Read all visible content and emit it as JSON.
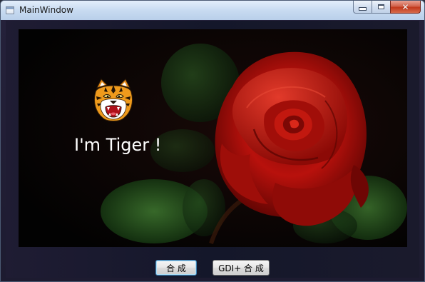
{
  "window": {
    "title": "MainWindow",
    "caption_buttons": {
      "minimize_icon": "minimize-icon",
      "maximize_icon": "maximize-icon",
      "close_icon": "close-icon",
      "close_glyph": "✕"
    }
  },
  "canvas": {
    "overlay_text": "I'm Tiger !",
    "tiger_icon": "tiger-head-icon",
    "background": "red-rose-photo"
  },
  "buttons": {
    "compose_label": "合 成",
    "gdi_compose_label": "GDI+ 合 成"
  },
  "colors": {
    "titlebar": "#c8dbf1",
    "client_bg": "#1a1a2c",
    "close_button": "#c2391d",
    "rose_red": "#c4140c",
    "leaf_green": "#2f5a24"
  }
}
